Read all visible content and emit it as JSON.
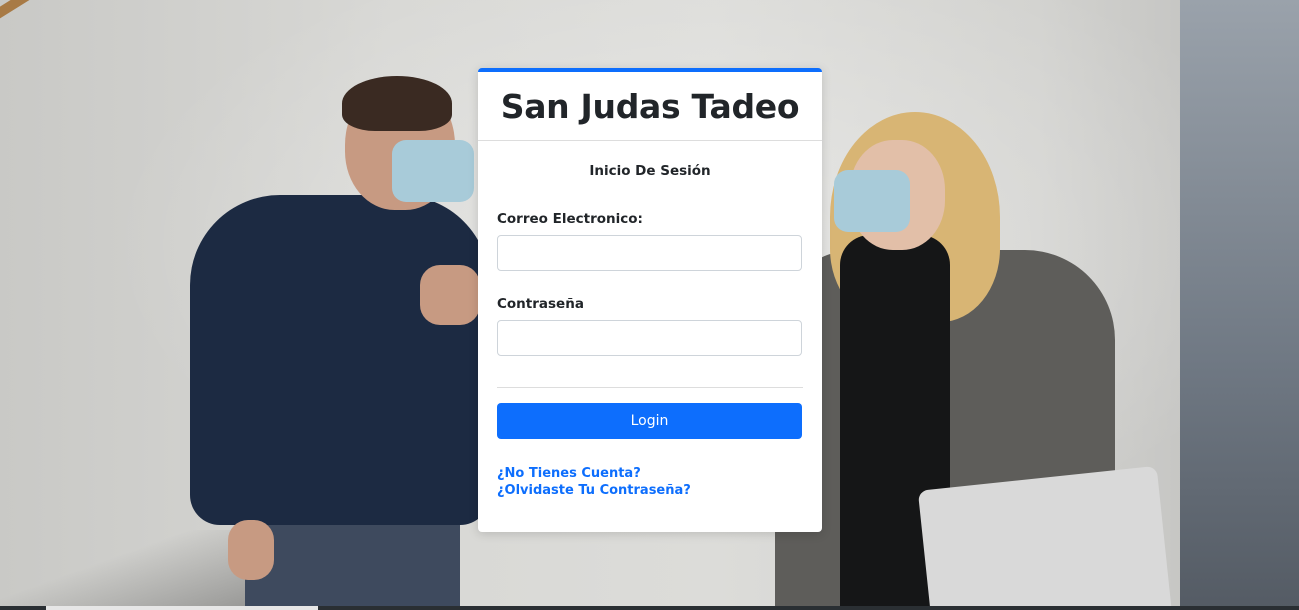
{
  "brand": {
    "title": "San Judas Tadeo"
  },
  "login": {
    "subtitle": "Inicio De Sesión",
    "email_label": "Correo Electronico:",
    "email_value": "",
    "password_label": "Contraseña",
    "password_value": "",
    "login_button": "Login",
    "no_account_link": "¿No Tienes Cuenta?",
    "forgot_password_link": "¿Olvidaste Tu Contraseña?"
  },
  "colors": {
    "accent": "#0d6efd",
    "card_background": "#ffffff",
    "text": "#212529"
  }
}
